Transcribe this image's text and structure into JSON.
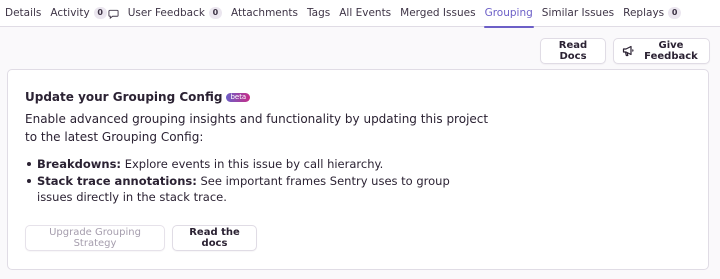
{
  "tabs": [
    {
      "label": "Details"
    },
    {
      "label": "Activity",
      "count": "0"
    },
    {
      "label": "User Feedback",
      "count": "0"
    },
    {
      "label": "Attachments"
    },
    {
      "label": "Tags"
    },
    {
      "label": "All Events"
    },
    {
      "label": "Merged Issues"
    },
    {
      "label": "Grouping",
      "active": true
    },
    {
      "label": "Similar Issues"
    },
    {
      "label": "Replays",
      "count": "0"
    }
  ],
  "actions": {
    "read_docs": "Read Docs",
    "give_feedback": "Give Feedback"
  },
  "card": {
    "title": "Update your Grouping Config",
    "badge": "beta",
    "description": "Enable advanced grouping insights and functionality by updating this project to the latest Grouping Config:",
    "bullets": [
      {
        "label": "Breakdowns:",
        "text": " Explore events in this issue by call hierarchy."
      },
      {
        "label": "Stack trace annotations:",
        "text": " See important frames Sentry uses to group issues directly in the stack trace."
      }
    ],
    "upgrade_button": "Upgrade Grouping Strategy",
    "read_docs_button": "Read the docs"
  },
  "colors": {
    "accent": "#6c5fc7",
    "badge_gradient_end": "#c62c88",
    "border": "#e0dce5",
    "text": "#2b2233"
  }
}
